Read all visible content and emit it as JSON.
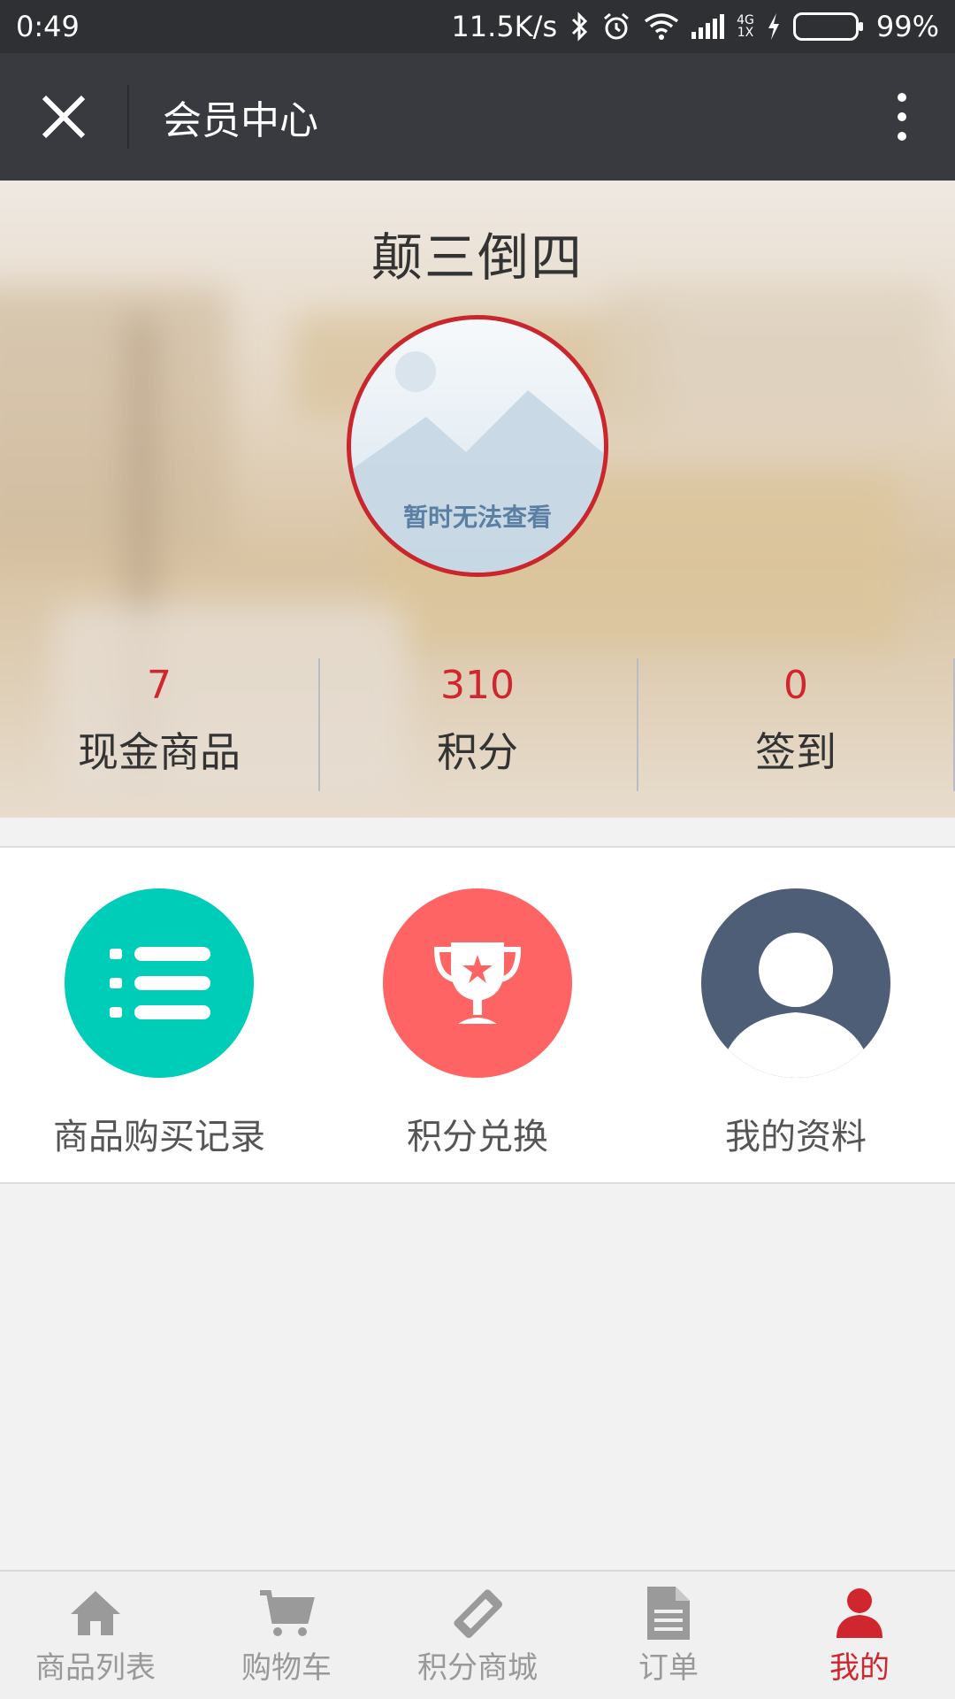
{
  "status_bar": {
    "time": "0:49",
    "net_speed": "11.5K/s",
    "net_type_top": "4G",
    "net_type_bottom": "1X",
    "battery": "99%"
  },
  "title_bar": {
    "title": "会员中心",
    "close_icon": "close-icon",
    "more_icon": "more-vertical-icon"
  },
  "profile": {
    "username": "颠三倒四",
    "avatar_placeholder": "暂时无法查看",
    "accent_color": "#c9262d"
  },
  "stats": [
    {
      "value": "7",
      "label": "现金商品"
    },
    {
      "value": "310",
      "label": "积分"
    },
    {
      "value": "0",
      "label": "签到"
    }
  ],
  "menu": [
    {
      "label": "商品购买记录",
      "icon": "list-icon",
      "color": "#00cdb7"
    },
    {
      "label": "积分兑换",
      "icon": "trophy-icon",
      "color": "#ff6464"
    },
    {
      "label": "我的资料",
      "icon": "user-icon",
      "color": "#4e5e76"
    }
  ],
  "tabs": [
    {
      "label": "商品列表",
      "icon": "home-icon",
      "active": false
    },
    {
      "label": "购物车",
      "icon": "cart-icon",
      "active": false
    },
    {
      "label": "积分商城",
      "icon": "ticket-icon",
      "active": false
    },
    {
      "label": "订单",
      "icon": "document-icon",
      "active": false
    },
    {
      "label": "我的",
      "icon": "user-icon",
      "active": true
    }
  ]
}
